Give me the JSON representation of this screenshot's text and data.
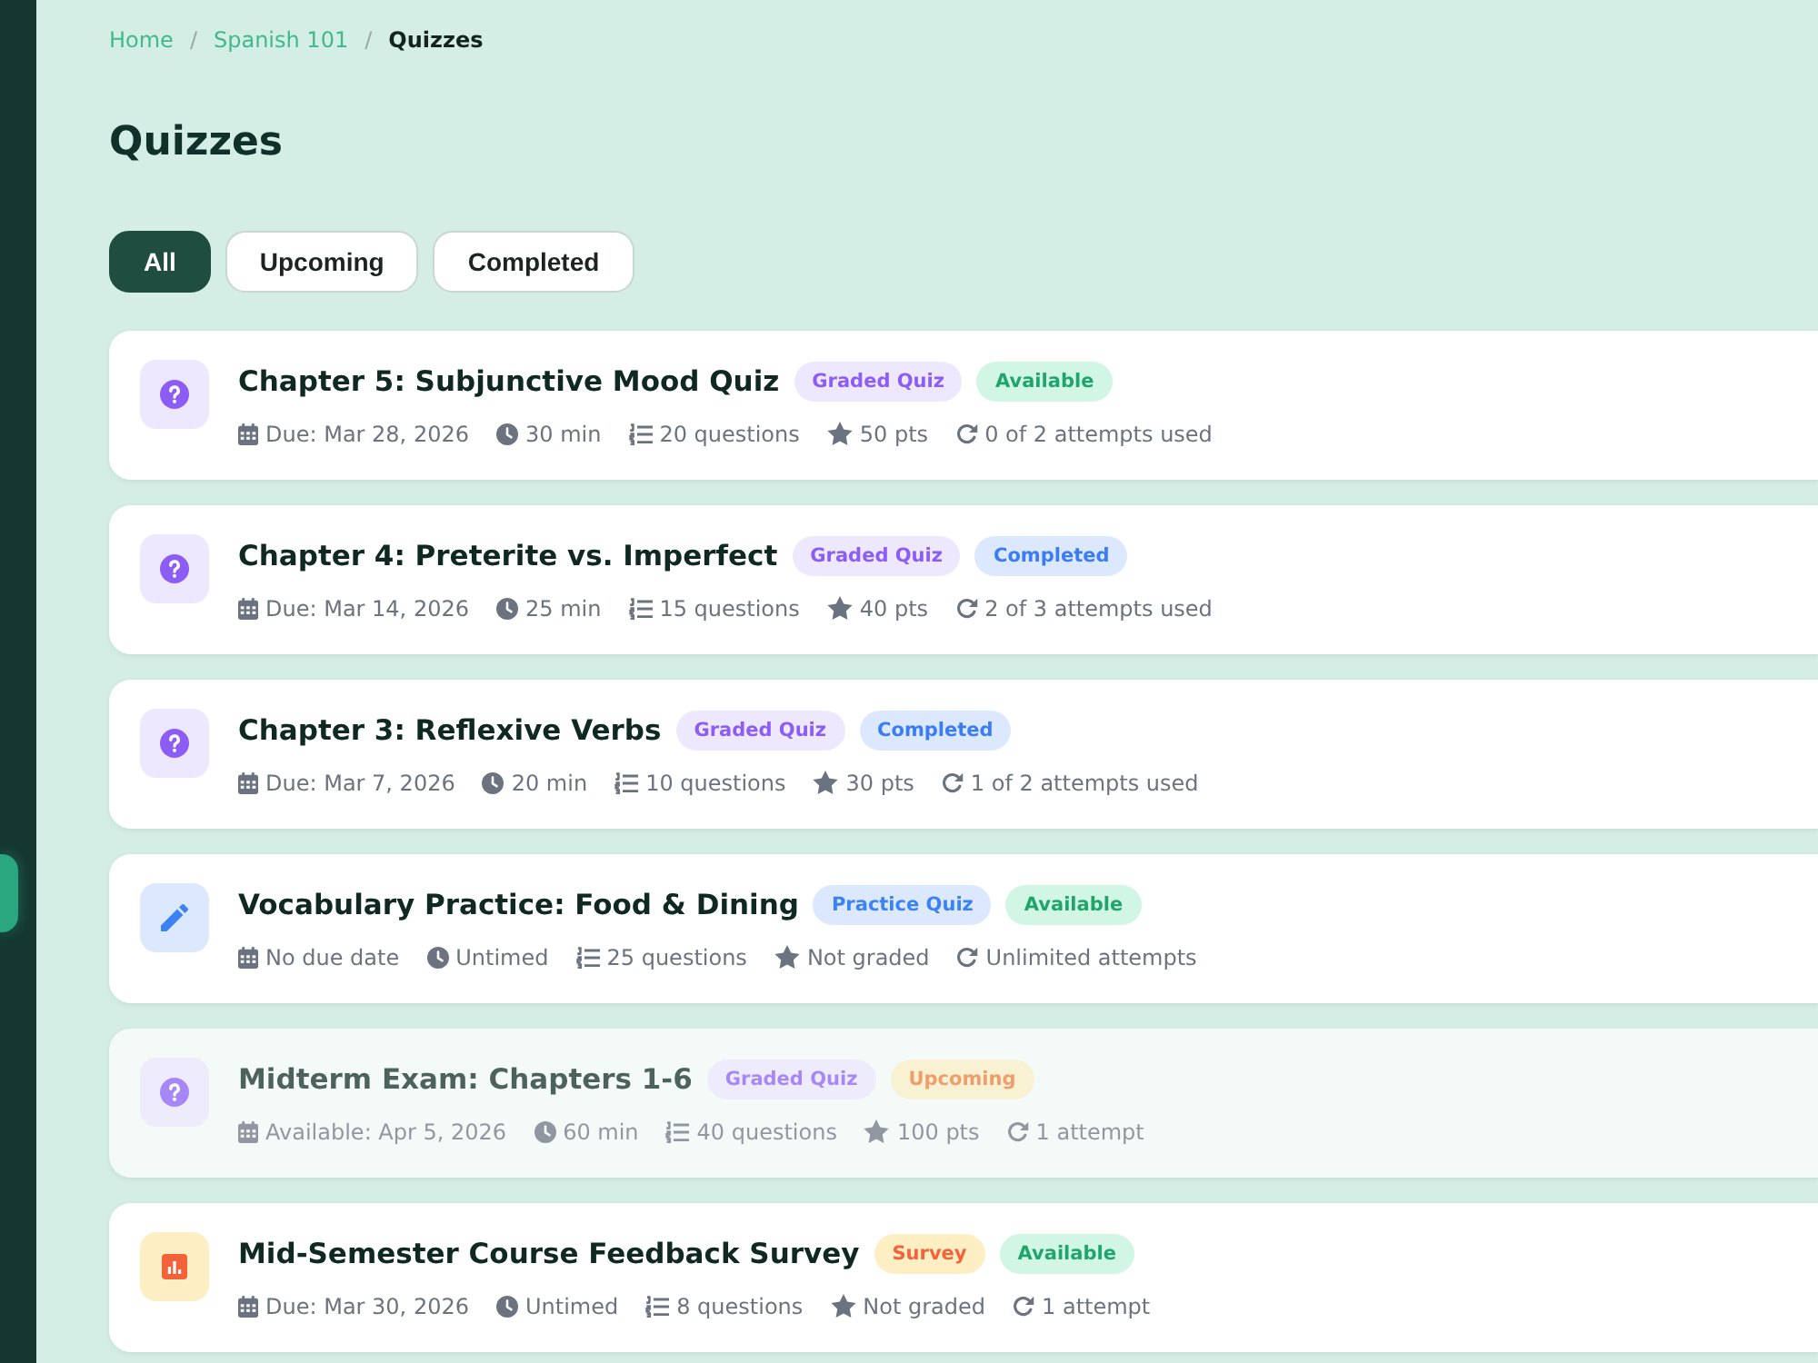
{
  "breadcrumb": {
    "separator": "/",
    "items": [
      {
        "label": "Home",
        "current": false
      },
      {
        "label": "Spanish 101",
        "current": false
      },
      {
        "label": "Quizzes",
        "current": true
      }
    ]
  },
  "page_title": "Quizzes",
  "tabs": [
    {
      "label": "All",
      "selected": true
    },
    {
      "label": "Upcoming",
      "selected": false
    },
    {
      "label": "Completed",
      "selected": false
    }
  ],
  "quizzes": [
    {
      "kind": "graded",
      "title": "Chapter 5: Subjunctive Mood Quiz",
      "disabled": false,
      "type_label": "Graded Quiz",
      "status": {
        "label": "Available",
        "kind": "available"
      },
      "meta": {
        "date": "Due: Mar 28, 2026",
        "duration": "30 min",
        "questions": "20 questions",
        "points": "50 pts",
        "attempts": "0 of 2 attempts used"
      }
    },
    {
      "kind": "graded",
      "title": "Chapter 4: Preterite vs. Imperfect",
      "disabled": false,
      "type_label": "Graded Quiz",
      "status": {
        "label": "Completed",
        "kind": "completed"
      },
      "meta": {
        "date": "Due: Mar 14, 2026",
        "duration": "25 min",
        "questions": "15 questions",
        "points": "40 pts",
        "attempts": "2 of 3 attempts used"
      }
    },
    {
      "kind": "graded",
      "title": "Chapter 3: Reflexive Verbs",
      "disabled": false,
      "type_label": "Graded Quiz",
      "status": {
        "label": "Completed",
        "kind": "completed"
      },
      "meta": {
        "date": "Due: Mar 7, 2026",
        "duration": "20 min",
        "questions": "10 questions",
        "points": "30 pts",
        "attempts": "1 of 2 attempts used"
      }
    },
    {
      "kind": "practice",
      "title": "Vocabulary Practice: Food & Dining",
      "disabled": false,
      "type_label": "Practice Quiz",
      "status": {
        "label": "Available",
        "kind": "available"
      },
      "meta": {
        "date": "No due date",
        "duration": "Untimed",
        "questions": "25 questions",
        "points": "Not graded",
        "attempts": "Unlimited attempts"
      }
    },
    {
      "kind": "graded",
      "title": "Midterm Exam: Chapters 1-6",
      "disabled": true,
      "type_label": "Graded Quiz",
      "status": {
        "label": "Upcoming",
        "kind": "upcoming"
      },
      "meta": {
        "date": "Available: Apr 5, 2026",
        "duration": "60 min",
        "questions": "40 questions",
        "points": "100 pts",
        "attempts": "1 attempt"
      }
    },
    {
      "kind": "survey",
      "title": "Mid-Semester Course Feedback Survey",
      "disabled": false,
      "type_label": "Survey",
      "status": {
        "label": "Available",
        "kind": "available"
      },
      "meta": {
        "date": "Due: Mar 30, 2026",
        "duration": "Untimed",
        "questions": "8 questions",
        "points": "Not graded",
        "attempts": "1 attempt"
      }
    }
  ]
}
